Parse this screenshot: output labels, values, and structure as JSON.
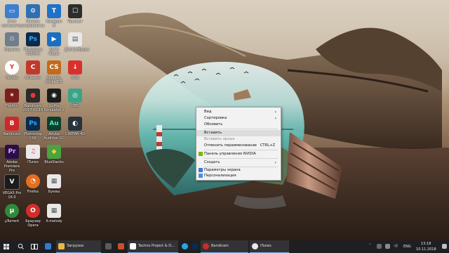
{
  "desktop": {
    "icons": [
      {
        "label": "Этот\nкомпьютер",
        "glyph": "▭",
        "color": "#3b7fd0"
      },
      {
        "label": "Панель\nуправления",
        "glyph": "⚙",
        "color": "#2f6fb3"
      },
      {
        "label": "Кэмерон\n8",
        "glyph": "T",
        "color": "#1d72c9"
      },
      {
        "label": "Чеклист",
        "glyph": "☐",
        "color": "#2d2d2d"
      },
      {
        "label": "Корзина",
        "glyph": "♲",
        "color": "#6f7d8c"
      },
      {
        "label": "Photoshop\nCS6(64)",
        "glyph": "Ps",
        "color": "#0b2b4a"
      },
      {
        "label": "Sutiti\nPlayer",
        "glyph": "▶",
        "color": "#1a6fc1"
      },
      {
        "label": "Дистрибуция",
        "glyph": "▤",
        "color": "#e8e8e8"
      },
      {
        "label": "Yandex",
        "glyph": "Y",
        "color": "#e33b2e"
      },
      {
        "label": "CCleaner",
        "glyph": "C",
        "color": "#c0392b"
      },
      {
        "label": "Counter-\nStrike 1.6",
        "glyph": "CS",
        "color": "#c46a1a"
      },
      {
        "label": "DVD",
        "glyph": "↓",
        "color": "#d8312b"
      },
      {
        "label": "FireSim",
        "glyph": "✶",
        "color": "#7a1d1d"
      },
      {
        "label": "Bandicam\n2017.01.16",
        "glyph": "●",
        "color": "#2b2b2b"
      },
      {
        "label": "GoPro\nSimulator 2",
        "glyph": "◉",
        "color": "#1c1c1c"
      },
      {
        "label": "OBS",
        "glyph": "◎",
        "color": "#3aa389"
      },
      {
        "label": "Bandicam",
        "glyph": "B",
        "color": "#cc2a2a"
      },
      {
        "label": "Photoshop\nCS6",
        "glyph": "Ps",
        "color": "#0b2b4a"
      },
      {
        "label": "Adobe\nAudition CC",
        "glyph": "Au",
        "color": "#0f3d2e"
      },
      {
        "label": "CINEMA 4D",
        "glyph": "◐",
        "color": "#26323c"
      },
      {
        "label": "Adobe\nPremiere Pro",
        "glyph": "Pr",
        "color": "#2a0f47"
      },
      {
        "label": "iTunes",
        "glyph": "♫",
        "color": "#e9e9e9"
      },
      {
        "label": "BlueStacks",
        "glyph": "◆",
        "color": "#4aa340"
      },
      {
        "label": "VEGAS Pro\n16.0",
        "glyph": "V",
        "color": "#1b1b1b"
      },
      {
        "label": "Firefox",
        "glyph": "◔",
        "color": "#e46f1f"
      },
      {
        "label": "Буквы",
        "glyph": "▦",
        "color": "#e8e8e8"
      },
      {
        "label": "µTorrent",
        "glyph": "µ",
        "color": "#2f8a3a"
      },
      {
        "label": "Браузер\nOpera",
        "glyph": "O",
        "color": "#d42c2c"
      },
      {
        "label": "X-melody",
        "glyph": "▦",
        "color": "#e8e8e8"
      }
    ]
  },
  "context_menu": {
    "items": [
      {
        "label": "Вид",
        "submenu": true,
        "state": "normal"
      },
      {
        "label": "Сортировка",
        "submenu": true,
        "state": "normal"
      },
      {
        "label": "Обновить",
        "submenu": false,
        "state": "normal"
      },
      {
        "label": "Вставить",
        "submenu": false,
        "state": "highlighted"
      },
      {
        "label": "Вставить ярлык",
        "submenu": false,
        "state": "disabled"
      },
      {
        "label": "Отменить переименование",
        "shortcut": "CTRL+Z",
        "state": "normal"
      },
      {
        "label": "Панель управления NVIDIA",
        "icon": "nvidia-icon",
        "state": "normal"
      },
      {
        "label": "Создать",
        "submenu": true,
        "state": "normal"
      },
      {
        "label": "Параметры экрана",
        "icon": "display-icon",
        "state": "normal"
      },
      {
        "label": "Персонализация",
        "icon": "personalize-icon",
        "state": "normal"
      }
    ]
  },
  "taskbar": {
    "buttons": [
      {
        "label": "Загрузки",
        "icon": "folder-icon",
        "color": "#e8b84a"
      },
      {
        "label": "Techno Project & D...",
        "icon": "yandex-icon",
        "color": "#e33b2e"
      },
      {
        "label": "Bandicam",
        "icon": "bandicam-icon",
        "color": "#cc2a2a"
      },
      {
        "label": "iTunes",
        "icon": "itunes-icon",
        "color": "#e9e9e9"
      }
    ],
    "tray": {
      "language": "ENG",
      "time": "13:18",
      "date": "10.11.2018"
    }
  },
  "colors": {
    "taskbar_bg": "#1f1f21",
    "accent": "#7fb2e5",
    "menu_bg": "#f2f2f2"
  }
}
